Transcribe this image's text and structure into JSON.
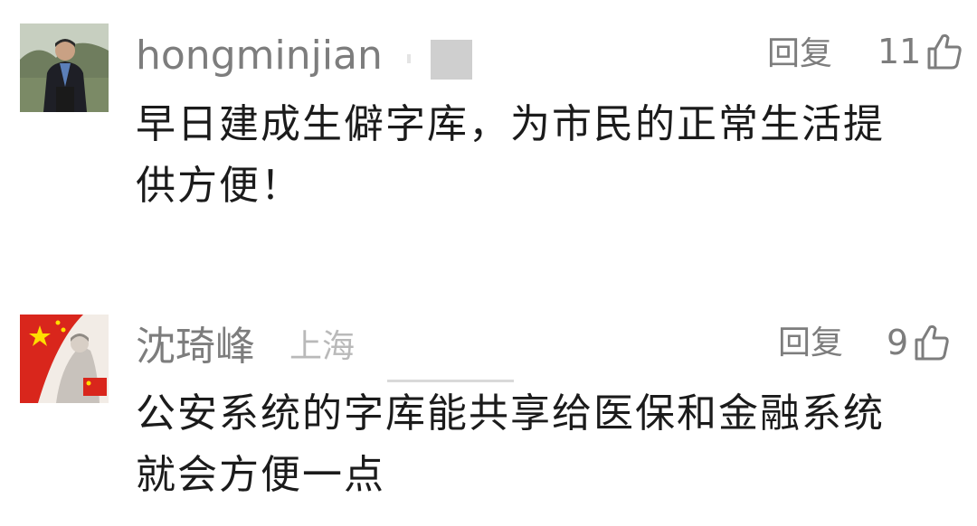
{
  "comments": [
    {
      "username": "hongminjian",
      "location": "",
      "reply_label": "回复",
      "like_count": "11",
      "text_lines": [
        "早日建成生僻字库，为市民的正常生活提",
        "供方便！"
      ]
    },
    {
      "username": "沈琦峰",
      "location": "上海",
      "reply_label": "回复",
      "like_count": "9",
      "text_lines": [
        "公安系统的字库能共享给医保和金融系统",
        "就会方便一点"
      ]
    }
  ],
  "colors": {
    "meta_text": "#7d7d7d",
    "location_text": "#b9b9b9",
    "body_text": "#1b1b1b",
    "flag_red": "#d9261c",
    "flag_star": "#ffde00"
  },
  "icons": {
    "like": "thumbs-up-icon"
  }
}
